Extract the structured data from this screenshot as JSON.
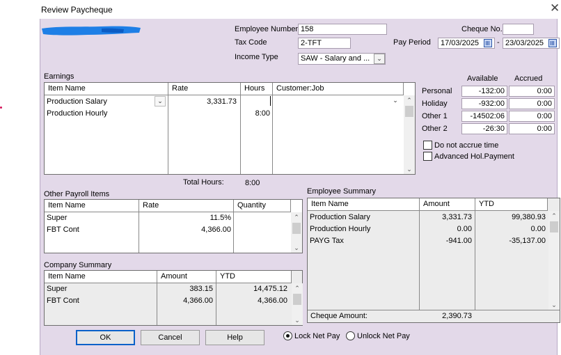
{
  "window": {
    "title": "Review Paycheque",
    "close_glyph": "✕"
  },
  "header": {
    "employee_number_label": "Employee Number",
    "employee_number": "158",
    "tax_code_label": "Tax Code",
    "tax_code": "2-TFT",
    "income_type_label": "Income Type",
    "income_type": "SAW - Salary and ...",
    "cheque_no_label": "Cheque No.",
    "cheque_no": "",
    "pay_period_label": "Pay Period",
    "period_from": "17/03/2025",
    "period_sep": "-",
    "period_to": "23/03/2025"
  },
  "earnings": {
    "label": "Earnings",
    "columns": [
      "Item Name",
      "Rate",
      "Hours",
      "Customer:Job"
    ],
    "rows": [
      {
        "item": "Production Salary",
        "rate": "3,331.73",
        "hours": "",
        "job": ""
      },
      {
        "item": "Production Hourly",
        "rate": "",
        "hours": "8:00",
        "job": ""
      }
    ],
    "total_hours_label": "Total Hours:",
    "total_hours": "8:00"
  },
  "leave": {
    "available_label": "Available",
    "accrued_label": "Accrued",
    "rows": [
      {
        "name": "Personal",
        "available": "-132:00",
        "accrued": "0:00"
      },
      {
        "name": "Holiday",
        "available": "-932:00",
        "accrued": "0:00"
      },
      {
        "name": "Other 1",
        "available": "-14502:06",
        "accrued": "0:00"
      },
      {
        "name": "Other 2",
        "available": "-26:30",
        "accrued": "0:00"
      }
    ],
    "do_not_accrue_label": "Do not accrue time",
    "advanced_hol_label": "Advanced Hol.Payment"
  },
  "other_payroll": {
    "label": "Other Payroll Items",
    "columns": [
      "Item Name",
      "Rate",
      "Quantity"
    ],
    "rows": [
      {
        "item": "Super",
        "rate": "11.5%",
        "qty": ""
      },
      {
        "item": "FBT Cont",
        "rate": "4,366.00",
        "qty": ""
      }
    ]
  },
  "employee_summary": {
    "label": "Employee Summary",
    "columns": [
      "Item Name",
      "Amount",
      "YTD"
    ],
    "rows": [
      {
        "item": "Production Salary",
        "amount": "3,331.73",
        "ytd": "99,380.93"
      },
      {
        "item": "Production Hourly",
        "amount": "0.00",
        "ytd": "0.00"
      },
      {
        "item": "PAYG Tax",
        "amount": "-941.00",
        "ytd": "-35,137.00"
      }
    ],
    "cheque_amount_label": "Cheque Amount:",
    "cheque_amount": "2,390.73"
  },
  "company_summary": {
    "label": "Company Summary",
    "columns": [
      "Item Name",
      "Amount",
      "YTD"
    ],
    "rows": [
      {
        "item": "Super",
        "amount": "383.15",
        "ytd": "14,475.12"
      },
      {
        "item": "FBT Cont",
        "amount": "4,366.00",
        "ytd": "4,366.00"
      }
    ]
  },
  "buttons": {
    "ok": "OK",
    "cancel": "Cancel",
    "help": "Help"
  },
  "net_pay": {
    "lock_label": "Lock Net Pay",
    "unlock_label": "Unlock Net Pay",
    "selected": "lock"
  },
  "colors": {
    "dialog_bg": "#e3d9e9",
    "redaction": "#1e7fe6",
    "default_button_border": "#0a61c9"
  }
}
